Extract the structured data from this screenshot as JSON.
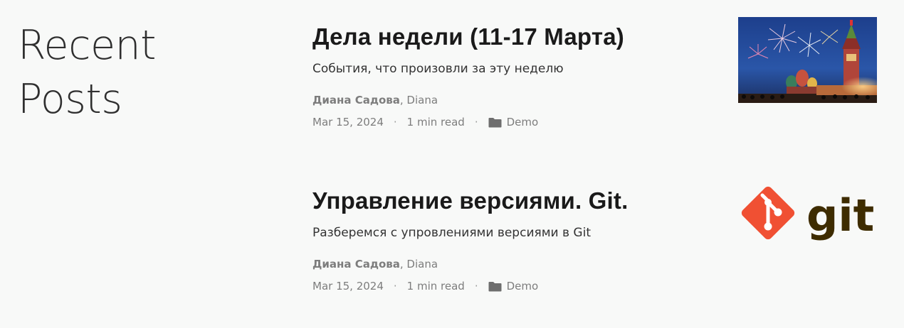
{
  "section": {
    "title_line1": "Recent",
    "title_line2": "Posts"
  },
  "posts": [
    {
      "title": "Дела недели (11-17 Марта)",
      "summary": "События, что произовли за эту неделю",
      "author_name": "Диана Садова",
      "author_rest": ", Diana",
      "date": "Mar 15, 2024",
      "read_time": "1 min read",
      "separator": "·",
      "category": "Demo",
      "thumbnail": "fireworks-over-kremlin-image"
    },
    {
      "title": "Управление версиями. Git.",
      "summary": "Разберемся с упровлениями версиями в Git",
      "author_name": "Диана Садова",
      "author_rest": ", Diana",
      "date": "Mar 15, 2024",
      "read_time": "1 min read",
      "separator": "·",
      "category": "Demo",
      "thumbnail": "git-logo-image",
      "thumbnail_text": "git"
    }
  ],
  "colors": {
    "background": "#f8f9f8",
    "title": "#1a1a1a",
    "meta": "#7d7d7d",
    "git_orange": "#f05033",
    "git_brown": "#3e2c00"
  }
}
